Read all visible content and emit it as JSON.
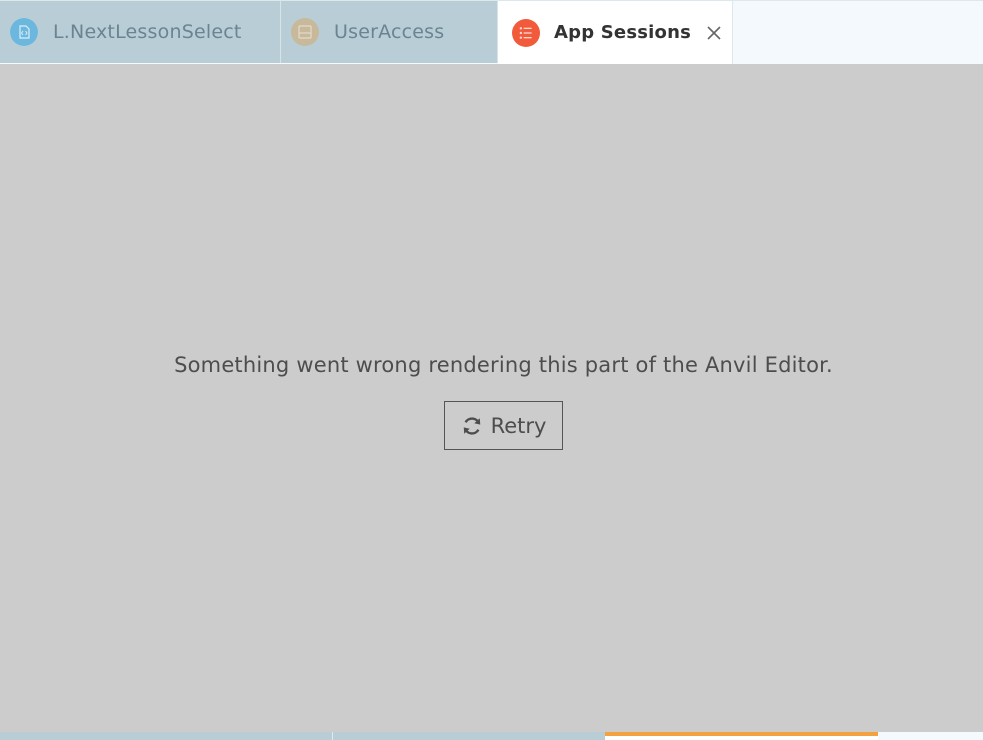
{
  "tabs": [
    {
      "label": "L.NextLessonSelect",
      "icon": "file-code-icon",
      "icon_color": "#6cb7dd",
      "active": false
    },
    {
      "label": "UserAccess",
      "icon": "form-icon",
      "icon_color": "#c8b99a",
      "active": false
    },
    {
      "label": "App Sessions",
      "icon": "list-icon",
      "icon_color": "#f25a3c",
      "active": true
    }
  ],
  "error": {
    "message": "Something went wrong rendering this part of the Anvil Editor.",
    "retry_label": "Retry"
  },
  "colors": {
    "accent_orange": "#f4a23f",
    "bottom_inactive": "#b8cdd6",
    "panel_gray": "#cccccc"
  }
}
